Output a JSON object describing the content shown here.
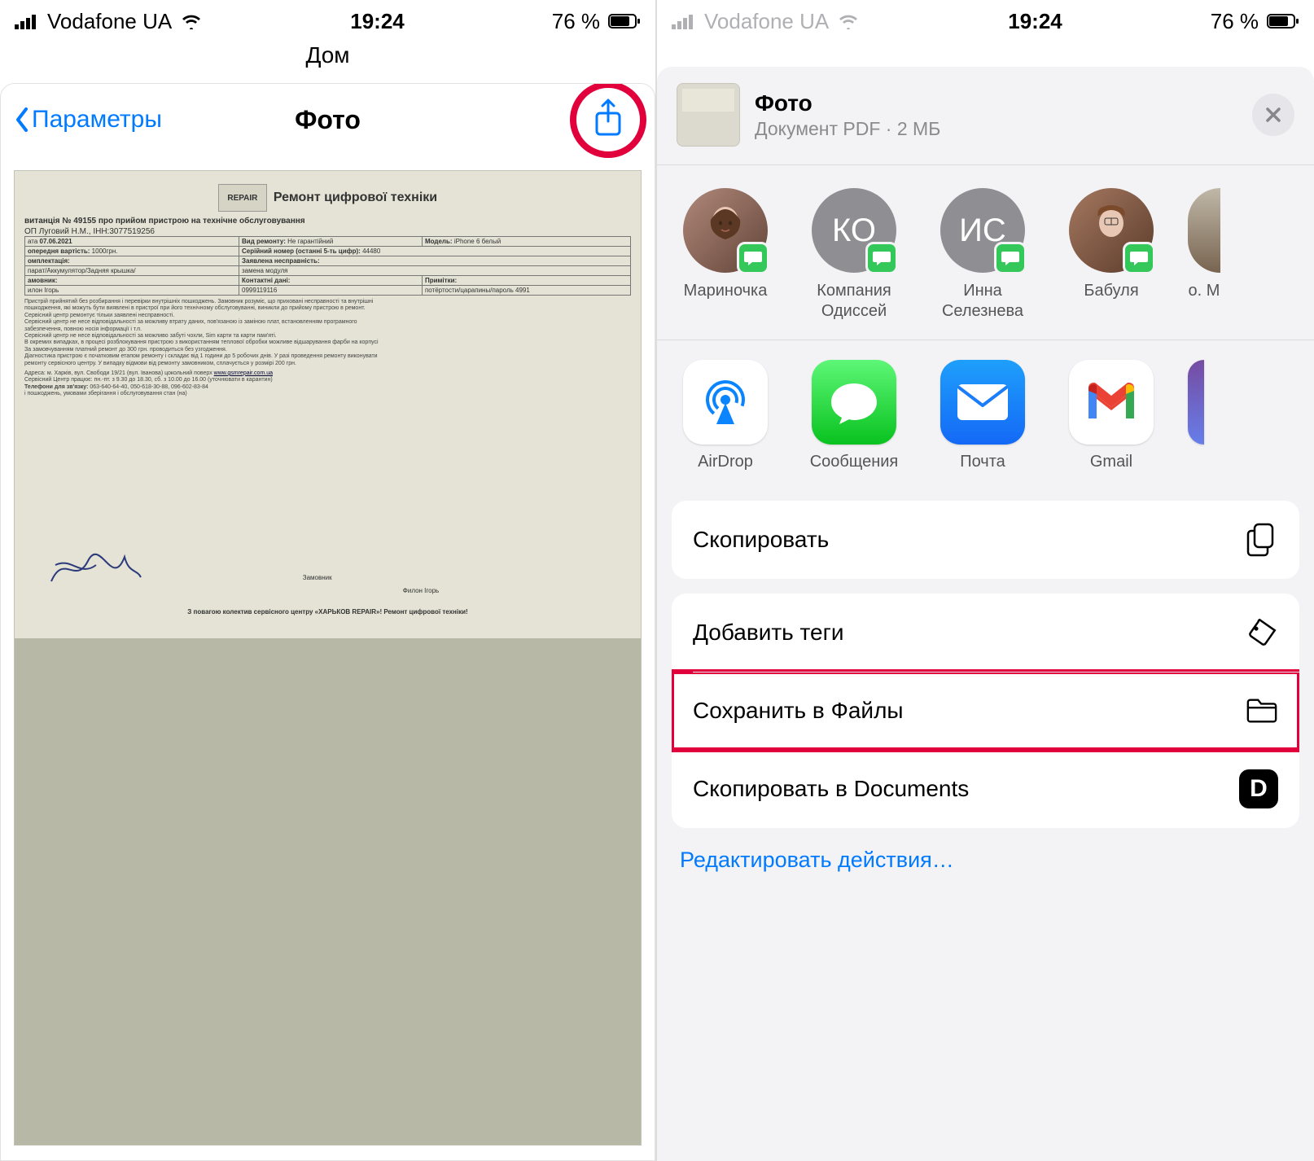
{
  "status": {
    "carrier": "Vodafone UA",
    "time": "19:24",
    "battery_text": "76 %"
  },
  "left": {
    "background_title": "Дом",
    "nav_back": "Параметры",
    "nav_title": "Фото",
    "doc": {
      "brand": "REPAIR",
      "heading": "Ремонт цифрової техніки",
      "receipt_line": "витанція № 49155 про прийом пристрою на технічне обслуговування",
      "owner_line": "ОП Луговий Н.М., ІНН:3077519256",
      "rows": {
        "date_label": "ата",
        "date_val": "07.06.2021",
        "repair_label": "Вид ремонту:",
        "repair_val": "Не гарантійний",
        "model_label": "Модель:",
        "model_val": "iPhone 6 белый",
        "prev_label": "опередня вартість:",
        "prev_val": "1000грн.",
        "serial_label": "Серійний номер (останні 5-ть цифр):",
        "serial_val": "44480",
        "equip_label": "омплектація:",
        "equip_val": "",
        "fault_label": "Заявлена несправність:",
        "fault_val": "",
        "equip_line": "парат/Аккумулятор/Задняя крышка/",
        "fault_line": "замена модуля",
        "customer_label": "амовник:",
        "contacts_label": "Контактні дані:",
        "notes_label": "Примітки:",
        "customer_val": "илон Ігорь",
        "contacts_val": "0999119116",
        "notes_val": "потёртости/царапины/пароль 4991"
      },
      "fine1": "Пристрій прийнятий без розбирання і перевірки внутрішніх пошкоджень. Замовник розуміє, що приховані несправності та внутрішні",
      "fine2": "пошкодження, які можуть бути виявлені в пристрої при його технічному обслуговуванні, виникли до прийому пристрою в ремонт.",
      "fine3": "Сервісний центр ремонтує тільки заявлені несправності.",
      "fine4": "Сервісний центр не несе відповідальності за можливу втрату даних, пов'язаною із заміною плат, встановленням програмного",
      "fine5": "Сервісний центр не несе відповідальності за можливо забуті чохли, Sim карти та карти пам'яті.",
      "fine6": "В окремих випадках, в процесі розблокування пристрою з використанням теплової обробки можливе відшарування фарби на корпусі",
      "fine7": "За замовчуванням платний ремонт до 300 грн. проводиться без узгодження.",
      "fine8": "Діагностика пристрою є початковим етапом ремонту і складає від 1 години до 5 робочих днів. У разі проведення ремонту виконувати",
      "fine9": "ремонту сервісного центру. У випадку відмови від ремонту замовником, сплачується у розмірі 200 грн.",
      "address": "Адреса: м. Харків, вул. Свободи 19/21 (вул. Іванова) цокольний поверх",
      "url": "www.gsmrepair.com.ua",
      "hours": "Сервісний Центр працює: пн.-пт. з 9.30 до 18.30, сб. з 10.00 до 16.00 (уточнювати в карантин)",
      "phones_label": "Телефони для зв'язку:",
      "phones": "063-640-64-40, 050-618-30-88, 096-602-83-84",
      "sig_left": "Замовник",
      "sig_right": "Филон Ігорь",
      "footer": "З повагою колектив сервісного центру «ХАРЬКОВ REPAIR»! Ремонт цифрової техніки!"
    }
  },
  "right": {
    "share_title": "Фото",
    "share_subtitle": "Документ PDF · 2 МБ",
    "contacts": [
      {
        "name": "Мариночка",
        "initials": "",
        "type": "photo1"
      },
      {
        "name": "Компания Одиссей",
        "initials": "КО",
        "type": "initials"
      },
      {
        "name": "Инна Селезнева",
        "initials": "ИС",
        "type": "initials"
      },
      {
        "name": "Бабуля",
        "initials": "",
        "type": "photo2"
      },
      {
        "name": "о. М",
        "initials": "",
        "type": "photo3"
      }
    ],
    "apps": [
      {
        "name": "AirDrop",
        "type": "airdrop"
      },
      {
        "name": "Сообщения",
        "type": "messages"
      },
      {
        "name": "Почта",
        "type": "mail"
      },
      {
        "name": "Gmail",
        "type": "gmail"
      },
      {
        "name": "",
        "type": "partial"
      }
    ],
    "actions": {
      "copy": "Скопировать",
      "tags": "Добавить теги",
      "save_files": "Сохранить в Файлы",
      "copy_docs": "Скопировать в Documents"
    },
    "edit_actions": "Редактировать действия…"
  }
}
